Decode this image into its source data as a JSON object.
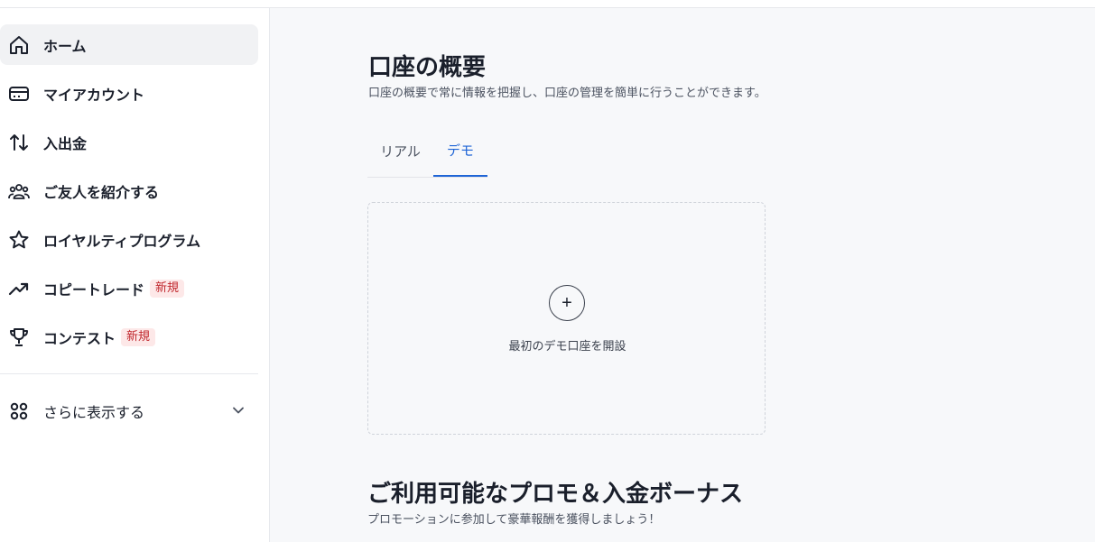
{
  "sidebar": {
    "items": [
      {
        "label": "ホーム",
        "icon": "home-icon"
      },
      {
        "label": "マイアカウント",
        "icon": "wallet-icon"
      },
      {
        "label": "入出金",
        "icon": "transfer-arrows-icon"
      },
      {
        "label": "ご友人を紹介する",
        "icon": "users-icon"
      },
      {
        "label": "ロイヤルティプログラム",
        "icon": "star-icon"
      },
      {
        "label": "コピートレード",
        "icon": "trending-up-icon",
        "badge": "新規"
      },
      {
        "label": "コンテスト",
        "icon": "trophy-icon",
        "badge": "新規"
      }
    ],
    "more_label": "さらに表示する",
    "more_icon": "grid-icon"
  },
  "overview": {
    "title": "口座の概要",
    "subtitle": "口座の概要で常に情報を把握し、口座の管理を簡単に行うことができます。",
    "tabs": [
      {
        "label": "リアル"
      },
      {
        "label": "デモ"
      }
    ],
    "active_tab": "デモ",
    "open_account_label": "最初のデモ口座を開設",
    "plus_symbol": "+"
  },
  "promo": {
    "title": "ご利用可能なプロモ＆入金ボーナス",
    "subtitle": "プロモーションに参加して豪華報酬を獲得しましょう！"
  },
  "colors": {
    "accent": "#1f65d6",
    "badge_bg": "#fde8e8",
    "badge_text": "#c0272d"
  }
}
